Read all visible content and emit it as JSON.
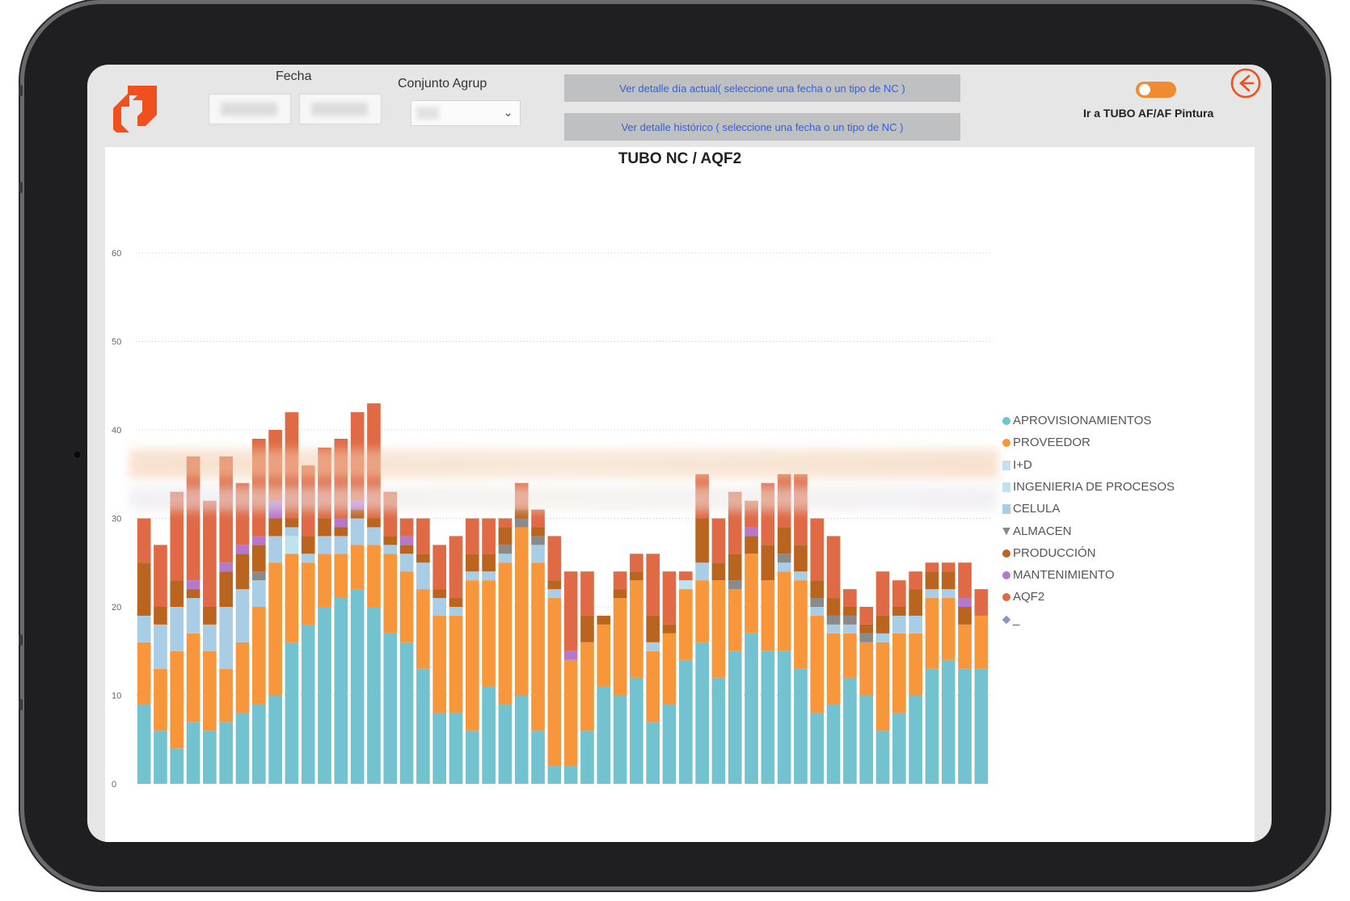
{
  "filters": {
    "fecha_label": "Fecha",
    "conjunto_label": "Conjunto Agrup"
  },
  "buttons": {
    "detalle_actual": "Ver detalle día actual( seleccione una fecha o un tipo de NC )",
    "detalle_historico": "Ver detalle histórico ( seleccione una fecha o un tipo de NC )"
  },
  "toggle": {
    "label": "Ir a TUBO AF/AF Pintura",
    "on": true
  },
  "colors": {
    "accent": "#f0501e",
    "aprovisionamientos": "#72c2d0",
    "proveedor": "#f7963a",
    "id": "#c9dff0",
    "ingenieria": "#bfe3ee",
    "celula": "#aacde6",
    "almacen": "#8a8a8a",
    "produccion": "#b9651f",
    "mantenimiento": "#b678c8",
    "aqf2": "#df6a45",
    "otro": "#8b95c9"
  },
  "icons": {
    "logo": "brand-logo-icon",
    "back": "arrow-left-circle-icon",
    "dropdown": "chevron-down-icon"
  },
  "chart_data": {
    "type": "bar",
    "stacked": true,
    "title": "TUBO NC / AQF2",
    "ylim": [
      0,
      65
    ],
    "yticks": [
      0,
      10,
      20,
      30,
      40,
      50,
      60
    ],
    "grid": true,
    "legend_position": "right",
    "series_names": [
      "APROVISIONAMIENTOS",
      "PROVEEDOR",
      "I+D",
      "INGENIERIA DE PROCESOS",
      "CELULA",
      "ALMACEN",
      "PRODUCCIÓN",
      "MANTENIMIENTO",
      "AQF2",
      "_"
    ],
    "legend_markers": [
      "circle",
      "circle",
      "square",
      "square",
      "square",
      "triangle",
      "circle",
      "circle",
      "circle",
      "diamond"
    ],
    "series_keys": [
      "aprovisionamientos",
      "proveedor",
      "id",
      "ingenieria",
      "celula",
      "almacen",
      "produccion",
      "mantenimiento",
      "aqf2",
      "otro"
    ],
    "stacks": [
      {
        "aprovisionamientos": 9,
        "proveedor": 7,
        "celula": 3,
        "produccion": 6,
        "aqf2": 5
      },
      {
        "aprovisionamientos": 6,
        "proveedor": 7,
        "celula": 5,
        "produccion": 2,
        "aqf2": 7
      },
      {
        "aprovisionamientos": 4,
        "proveedor": 11,
        "celula": 5,
        "produccion": 3,
        "aqf2": 10
      },
      {
        "aprovisionamientos": 7,
        "proveedor": 10,
        "celula": 4,
        "produccion": 1,
        "mantenimiento": 1,
        "aqf2": 14
      },
      {
        "aprovisionamientos": 6,
        "proveedor": 9,
        "celula": 3,
        "produccion": 2,
        "aqf2": 12
      },
      {
        "aprovisionamientos": 7,
        "proveedor": 6,
        "celula": 7,
        "produccion": 4,
        "mantenimiento": 1,
        "aqf2": 12
      },
      {
        "aprovisionamientos": 8,
        "proveedor": 8,
        "celula": 6,
        "produccion": 4,
        "mantenimiento": 1,
        "aqf2": 7
      },
      {
        "aprovisionamientos": 9,
        "proveedor": 11,
        "celula": 3,
        "almacen": 1,
        "produccion": 3,
        "mantenimiento": 1,
        "aqf2": 11
      },
      {
        "aprovisionamientos": 10,
        "proveedor": 15,
        "celula": 3,
        "produccion": 2,
        "mantenimiento": 2,
        "aqf2": 8
      },
      {
        "aprovisionamientos": 16,
        "proveedor": 10,
        "ingenieria": 2,
        "celula": 1,
        "produccion": 1,
        "aqf2": 12
      },
      {
        "aprovisionamientos": 18,
        "proveedor": 7,
        "celula": 1,
        "produccion": 2,
        "aqf2": 8
      },
      {
        "aprovisionamientos": 20,
        "proveedor": 6,
        "celula": 2,
        "produccion": 2,
        "aqf2": 8
      },
      {
        "aprovisionamientos": 21,
        "proveedor": 5,
        "celula": 2,
        "produccion": 1,
        "mantenimiento": 1,
        "aqf2": 9
      },
      {
        "aprovisionamientos": 22,
        "proveedor": 5,
        "celula": 3,
        "produccion": 1,
        "mantenimiento": 1,
        "aqf2": 10
      },
      {
        "aprovisionamientos": 20,
        "proveedor": 7,
        "celula": 2,
        "produccion": 1,
        "aqf2": 13
      },
      {
        "aprovisionamientos": 17,
        "proveedor": 9,
        "celula": 1,
        "produccion": 1,
        "aqf2": 5
      },
      {
        "aprovisionamientos": 16,
        "proveedor": 8,
        "celula": 2,
        "produccion": 1,
        "mantenimiento": 1,
        "aqf2": 2
      },
      {
        "aprovisionamientos": 13,
        "proveedor": 9,
        "celula": 3,
        "produccion": 1,
        "aqf2": 4
      },
      {
        "aprovisionamientos": 8,
        "proveedor": 11,
        "celula": 2,
        "produccion": 1,
        "aqf2": 5
      },
      {
        "aprovisionamientos": 8,
        "proveedor": 11,
        "celula": 1,
        "produccion": 1,
        "aqf2": 7
      },
      {
        "aprovisionamientos": 6,
        "proveedor": 17,
        "celula": 1,
        "produccion": 2,
        "aqf2": 4
      },
      {
        "aprovisionamientos": 11,
        "proveedor": 12,
        "celula": 1,
        "produccion": 2,
        "aqf2": 4
      },
      {
        "aprovisionamientos": 9,
        "proveedor": 16,
        "celula": 1,
        "almacen": 1,
        "produccion": 2,
        "aqf2": 1
      },
      {
        "aprovisionamientos": 10,
        "proveedor": 19,
        "almacen": 1,
        "produccion": 1,
        "aqf2": 3
      },
      {
        "aprovisionamientos": 6,
        "proveedor": 19,
        "celula": 2,
        "almacen": 1,
        "produccion": 1,
        "aqf2": 2
      },
      {
        "aprovisionamientos": 2,
        "proveedor": 19,
        "celula": 1,
        "produccion": 1,
        "aqf2": 5
      },
      {
        "aprovisionamientos": 2,
        "proveedor": 12,
        "mantenimiento": 1,
        "aqf2": 9
      },
      {
        "aprovisionamientos": 6,
        "proveedor": 10,
        "produccion": 3,
        "aqf2": 5
      },
      {
        "aprovisionamientos": 11,
        "proveedor": 7,
        "produccion": 1,
        "aqf2": 0
      },
      {
        "aprovisionamientos": 10,
        "proveedor": 11,
        "produccion": 1,
        "aqf2": 2
      },
      {
        "aprovisionamientos": 12,
        "proveedor": 11,
        "produccion": 1,
        "aqf2": 2
      },
      {
        "aprovisionamientos": 7,
        "proveedor": 8,
        "celula": 1,
        "produccion": 3,
        "aqf2": 7
      },
      {
        "aprovisionamientos": 9,
        "proveedor": 8,
        "produccion": 1,
        "aqf2": 6
      },
      {
        "aprovisionamientos": 14,
        "proveedor": 8,
        "ingenieria": 1,
        "aqf2": 1
      },
      {
        "aprovisionamientos": 16,
        "proveedor": 7,
        "celula": 2,
        "produccion": 5,
        "aqf2": 5
      },
      {
        "aprovisionamientos": 12,
        "proveedor": 11,
        "produccion": 2,
        "aqf2": 5
      },
      {
        "aprovisionamientos": 15,
        "proveedor": 7,
        "almacen": 1,
        "produccion": 3,
        "aqf2": 7
      },
      {
        "aprovisionamientos": 17,
        "proveedor": 9,
        "produccion": 2,
        "mantenimiento": 1,
        "aqf2": 3
      },
      {
        "aprovisionamientos": 15,
        "proveedor": 8,
        "produccion": 4,
        "aqf2": 7
      },
      {
        "aprovisionamientos": 15,
        "proveedor": 9,
        "celula": 1,
        "almacen": 1,
        "produccion": 3,
        "aqf2": 6
      },
      {
        "aprovisionamientos": 13,
        "proveedor": 10,
        "celula": 1,
        "produccion": 3,
        "aqf2": 8
      },
      {
        "aprovisionamientos": 8,
        "proveedor": 11,
        "celula": 1,
        "almacen": 1,
        "produccion": 2,
        "aqf2": 7
      },
      {
        "aprovisionamientos": 9,
        "proveedor": 8,
        "celula": 1,
        "almacen": 1,
        "produccion": 2,
        "aqf2": 7
      },
      {
        "aprovisionamientos": 12,
        "proveedor": 5,
        "celula": 1,
        "almacen": 1,
        "produccion": 1,
        "aqf2": 2
      },
      {
        "aprovisionamientos": 10,
        "proveedor": 6,
        "almacen": 1,
        "produccion": 1,
        "aqf2": 2
      },
      {
        "aprovisionamientos": 6,
        "proveedor": 10,
        "celula": 1,
        "produccion": 2,
        "aqf2": 5
      },
      {
        "aprovisionamientos": 8,
        "proveedor": 9,
        "celula": 2,
        "produccion": 1,
        "aqf2": 3
      },
      {
        "aprovisionamientos": 10,
        "proveedor": 7,
        "celula": 2,
        "produccion": 3,
        "aqf2": 2
      },
      {
        "aprovisionamientos": 13,
        "proveedor": 8,
        "celula": 1,
        "produccion": 2,
        "aqf2": 1
      },
      {
        "aprovisionamientos": 14,
        "proveedor": 7,
        "celula": 1,
        "produccion": 2,
        "aqf2": 1
      },
      {
        "aprovisionamientos": 13,
        "proveedor": 5,
        "produccion": 2,
        "mantenimiento": 1,
        "aqf2": 4
      },
      {
        "aprovisionamientos": 13,
        "proveedor": 6,
        "aqf2": 3
      }
    ]
  }
}
